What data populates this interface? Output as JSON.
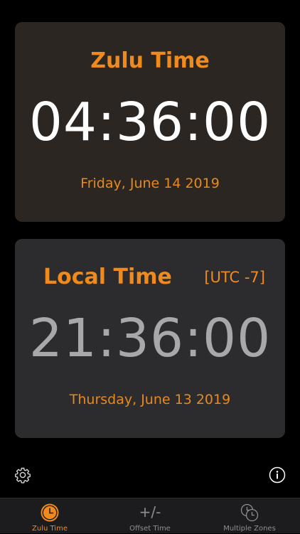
{
  "zulu_card": {
    "title": "Zulu Time",
    "time": "04:36:00",
    "date": "Friday, June 14 2019"
  },
  "local_card": {
    "title": "Local Time",
    "utc_offset": "[UTC -7]",
    "time": "21:36:00",
    "date": "Thursday, June 13 2019"
  },
  "toolbar": {
    "settings_icon": "gear-icon",
    "info_icon": "info-icon"
  },
  "tab_bar": {
    "tabs": [
      {
        "label": "Zulu Time",
        "icon": "clock-icon",
        "active": true
      },
      {
        "label": "Offset Time",
        "glyph": "+/-",
        "icon": "plus-minus-icon",
        "active": false
      },
      {
        "label": "Multiple Zones",
        "icon": "multiple-clocks-icon",
        "active": false
      }
    ]
  },
  "colors": {
    "accent": "#f08a1c",
    "zulu_card_bg": "#2b2622",
    "local_card_bg": "#2c2c2e",
    "local_time_text": "#a8a8aa",
    "inactive_tab": "#8e8e93"
  }
}
